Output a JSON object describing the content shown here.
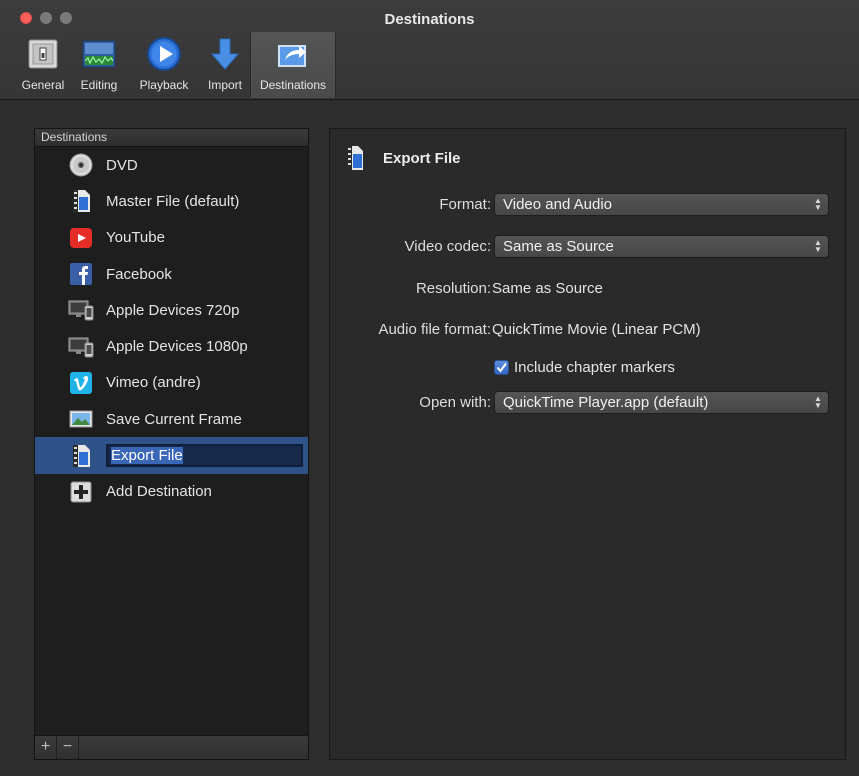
{
  "window": {
    "title": "Destinations"
  },
  "toolbar": {
    "items": [
      {
        "label": "General",
        "icon": "general-switch-icon"
      },
      {
        "label": "Editing",
        "icon": "editing-waveform-icon"
      },
      {
        "label": "Playback",
        "icon": "playback-icon"
      },
      {
        "label": "Import",
        "icon": "import-arrow-icon"
      },
      {
        "label": "Destinations",
        "icon": "destinations-share-icon",
        "selected": true
      }
    ]
  },
  "sidebar": {
    "header": "Destinations",
    "items": [
      {
        "label": "DVD",
        "icon": "dvd-icon"
      },
      {
        "label": "Master File (default)",
        "icon": "film-file-icon"
      },
      {
        "label": "YouTube",
        "icon": "youtube-icon"
      },
      {
        "label": "Facebook",
        "icon": "facebook-icon"
      },
      {
        "label": "Apple Devices 720p",
        "icon": "apple-devices-icon"
      },
      {
        "label": "Apple Devices 1080p",
        "icon": "apple-devices-icon"
      },
      {
        "label": "Vimeo (andre)",
        "icon": "vimeo-icon"
      },
      {
        "label": "Save Current Frame",
        "icon": "image-frame-icon"
      },
      {
        "label": "Export File",
        "icon": "film-file-icon",
        "selected": true,
        "editing": true
      },
      {
        "label": "Add Destination",
        "icon": "plus-icon"
      }
    ],
    "footer": {
      "add": "+",
      "remove": "−"
    }
  },
  "detail": {
    "title": "Export File",
    "format": {
      "label": "Format:",
      "value": "Video and Audio"
    },
    "video_codec": {
      "label": "Video codec:",
      "value": "Same as Source"
    },
    "resolution": {
      "label": "Resolution:",
      "value": "Same as Source"
    },
    "audio_format": {
      "label": "Audio file format:",
      "value": "QuickTime Movie (Linear PCM)"
    },
    "chapter_markers": {
      "label": "Include chapter markers",
      "checked": true
    },
    "open_with": {
      "label": "Open with:",
      "value": "QuickTime Player.app (default)"
    }
  },
  "colors": {
    "selection": "#2f5288",
    "close_button": "#fc605c",
    "checkbox_accent": "#3d74d4"
  }
}
